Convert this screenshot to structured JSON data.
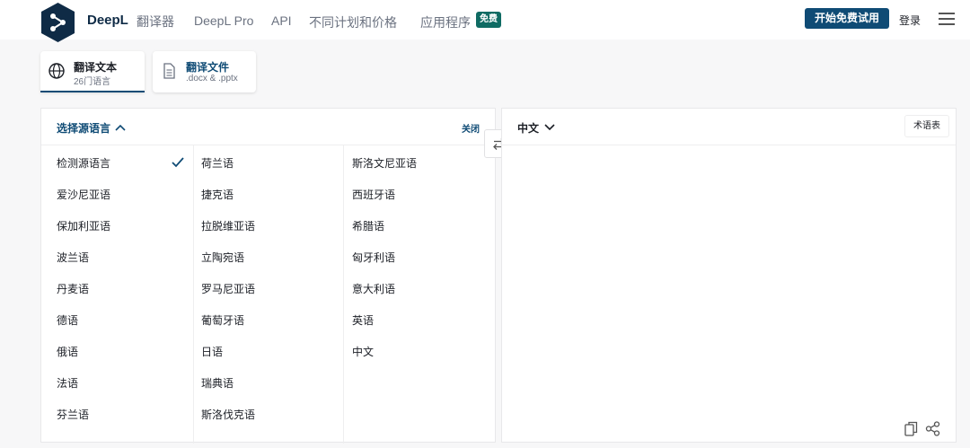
{
  "header": {
    "brand": "DeepL",
    "brand_sub": "翻译器",
    "nav": [
      "DeepL Pro",
      "API",
      "不同计划和价格",
      "应用程序"
    ],
    "free_badge": "免费",
    "trial_button": "开始免费试用",
    "login": "登录"
  },
  "tabs": [
    {
      "title": "翻译文本",
      "subtitle": "26门语言"
    },
    {
      "title": "翻译文件",
      "subtitle": ".docx & .pptx"
    }
  ],
  "source_panel": {
    "label": "选择源语言",
    "close": "关闭",
    "languages": [
      [
        "检测源语言",
        "爱沙尼亚语",
        "保加利亚语",
        "波兰语",
        "丹麦语",
        "德语",
        "俄语",
        "法语",
        "芬兰语"
      ],
      [
        "荷兰语",
        "捷克语",
        "拉脱维亚语",
        "立陶宛语",
        "罗马尼亚语",
        "葡萄牙语",
        "日语",
        "瑞典语",
        "斯洛伐克语"
      ],
      [
        "斯洛文尼亚语",
        "西班牙语",
        "希腊语",
        "匈牙利语",
        "意大利语",
        "英语",
        "中文"
      ]
    ],
    "selected": "检测源语言"
  },
  "target_panel": {
    "label": "中文",
    "glossary": "术语表"
  },
  "colors": {
    "accent": "#0f4b75",
    "badge": "#0f6b63",
    "logo": "#0f2b46"
  }
}
